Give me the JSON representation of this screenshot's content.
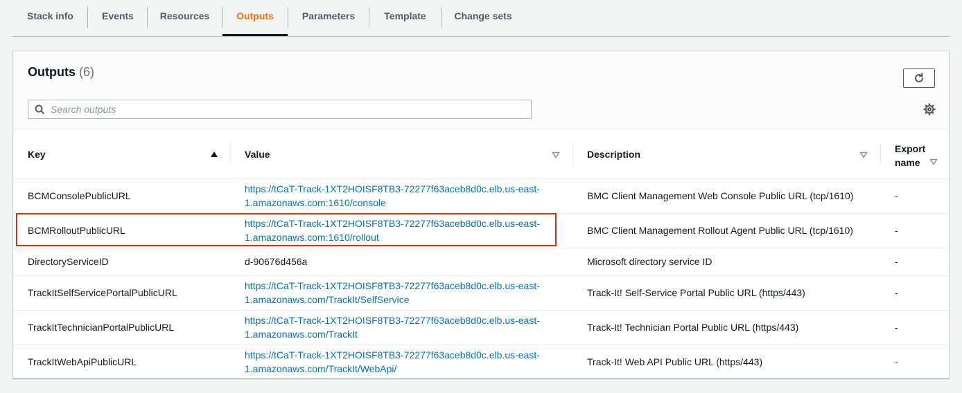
{
  "tabs": [
    {
      "label": "Stack info"
    },
    {
      "label": "Events"
    },
    {
      "label": "Resources"
    },
    {
      "label": "Outputs"
    },
    {
      "label": "Parameters"
    },
    {
      "label": "Template"
    },
    {
      "label": "Change sets"
    }
  ],
  "active_tab": "Outputs",
  "panel": {
    "title": "Outputs",
    "count": "(6)",
    "search_placeholder": "Search outputs",
    "search_value": ""
  },
  "columns": {
    "key": "Key",
    "value": "Value",
    "description": "Description",
    "export_line1": "Export",
    "export_line2": "name"
  },
  "rows": [
    {
      "key": "BCMConsolePublicURL",
      "value_line1": "https://tCaT-Track-1XT2HOISF8TB3-72277f63aceb8d0c.elb.us-east-",
      "value_line2": "1.amazonaws.com:1610/console",
      "description": "BMC Client Management Web Console Public URL (tcp/1610)",
      "export": "-"
    },
    {
      "key": "BCMRolloutPublicURL",
      "value_line1": "https://tCaT-Track-1XT2HOISF8TB3-72277f63aceb8d0c.elb.us-east-",
      "value_line2": "1.amazonaws.com:1610/rollout",
      "description": "BMC Client Management Rollout Agent Public URL (tcp/1610)",
      "export": "-"
    },
    {
      "key": "DirectoryServiceID",
      "value_line1": "d-90676d456a",
      "value_line2": "",
      "description": "Microsoft directory service ID",
      "export": "-"
    },
    {
      "key": "TrackItSelfServicePortalPublicURL",
      "value_line1": "https://tCaT-Track-1XT2HOISF8TB3-72277f63aceb8d0c.elb.us-east-",
      "value_line2": "1.amazonaws.com/TrackIt/SelfService",
      "description": "Track-It! Self-Service Portal Public URL (https/443)",
      "export": "-"
    },
    {
      "key": "TrackItTechnicianPortalPublicURL",
      "value_line1": "https://tCaT-Track-1XT2HOISF8TB3-72277f63aceb8d0c.elb.us-east-",
      "value_line2": "1.amazonaws.com/TrackIt",
      "description": "Track-It! Technician Portal Public URL (https/443)",
      "export": "-"
    },
    {
      "key": "TrackItWebApiPublicURL",
      "value_line1": "https://tCaT-Track-1XT2HOISF8TB3-72277f63aceb8d0c.elb.us-east-",
      "value_line2": "1.amazonaws.com/TrackIt/WebApi/",
      "description": "Track-It! Web API Public URL (https/443)",
      "export": "-"
    }
  ],
  "colors": {
    "active_tab": "#ec7211",
    "link": "#0073bb",
    "highlight": "#d13212"
  },
  "icons": {
    "refresh": "refresh-icon",
    "search": "search-icon",
    "settings": "gear-icon",
    "sort_asc": "sort-ascending-icon",
    "sort": "sort-icon"
  }
}
